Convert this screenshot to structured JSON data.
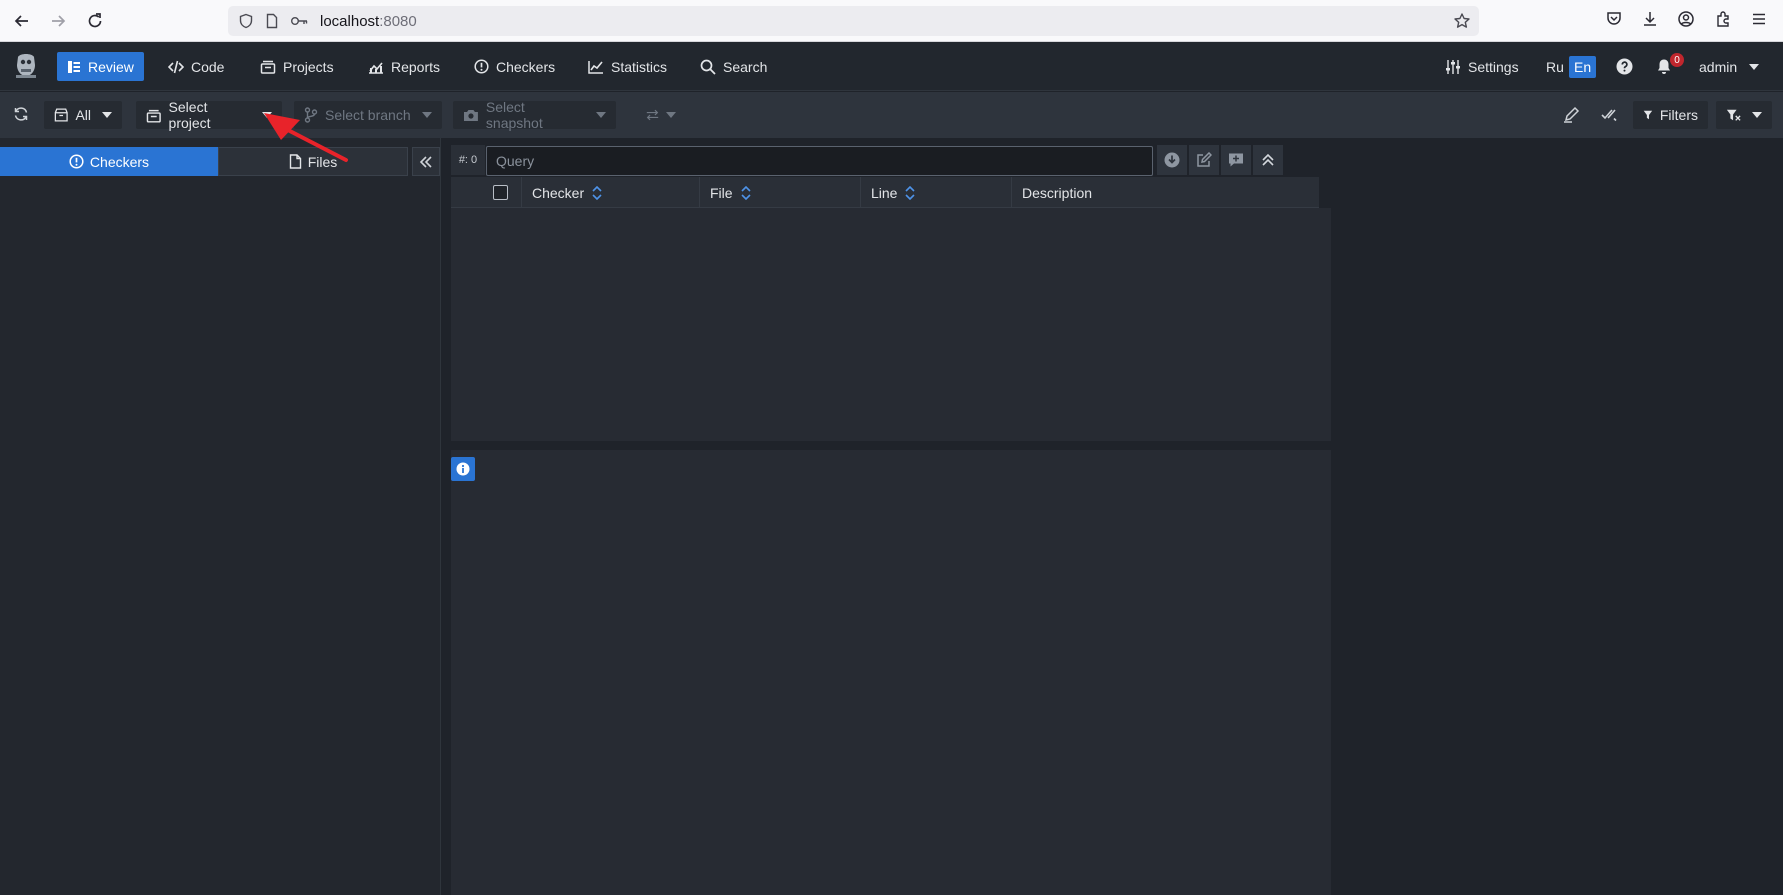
{
  "browser": {
    "url_host": "localhost",
    "url_port": ":8080"
  },
  "navbar": {
    "items": [
      {
        "label": "Review",
        "icon": "review-icon",
        "active": true
      },
      {
        "label": "Code",
        "icon": "code-icon"
      },
      {
        "label": "Projects",
        "icon": "projects-icon"
      },
      {
        "label": "Reports",
        "icon": "reports-icon"
      },
      {
        "label": "Checkers",
        "icon": "exclamation-circle-icon"
      },
      {
        "label": "Statistics",
        "icon": "chart-icon"
      },
      {
        "label": "Search",
        "icon": "search-icon"
      }
    ],
    "settings_label": "Settings",
    "lang_ru": "Ru",
    "lang_en": "En",
    "notifications_count": "0",
    "user": "admin"
  },
  "toolbar": {
    "scope_label": "All",
    "project_label": "Select project",
    "branch_label": "Select branch",
    "snapshot_label": "Select snapshot",
    "filters_label": "Filters"
  },
  "left_panel": {
    "tab_checkers": "Checkers",
    "tab_files": "Files"
  },
  "query": {
    "count": "#: 0",
    "placeholder": "Query"
  },
  "table": {
    "columns": [
      "Checker",
      "File",
      "Line",
      "Description"
    ]
  },
  "colors": {
    "accent": "#2a74d3",
    "background": "#1f232a",
    "panel": "#272b33",
    "badge": "#c0262d",
    "annotation_arrow": "#e8232a"
  }
}
